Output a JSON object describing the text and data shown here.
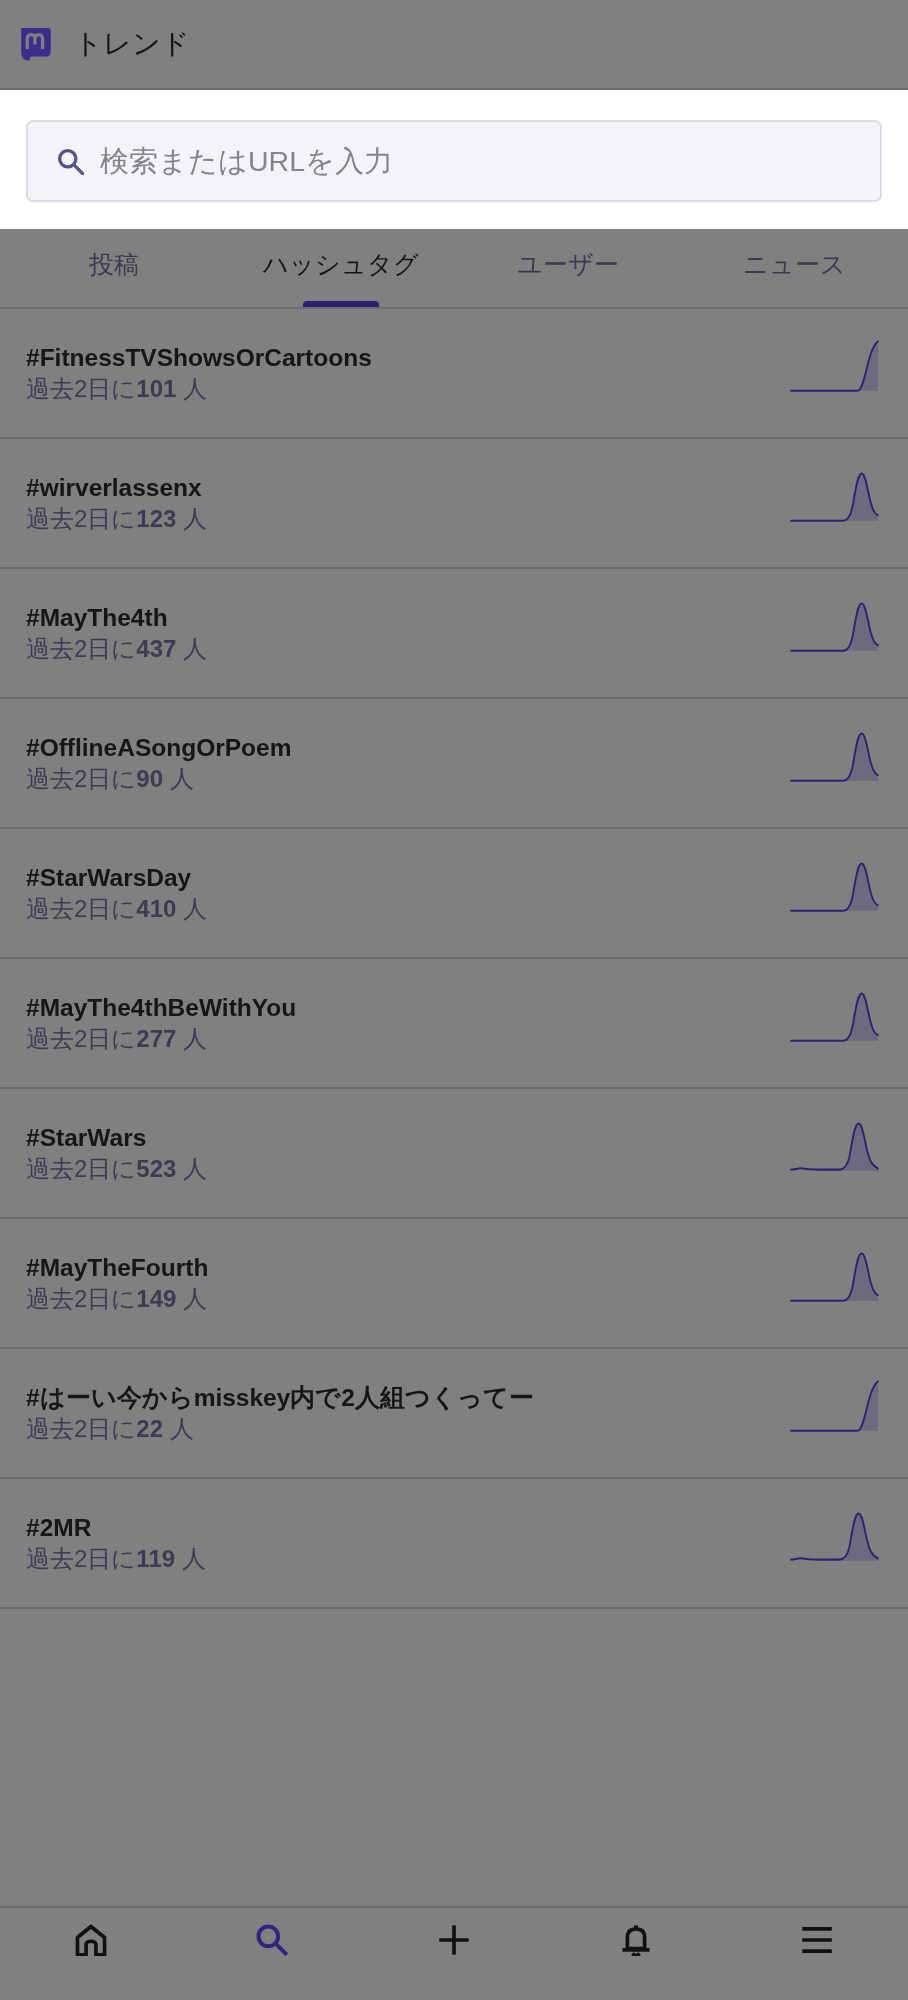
{
  "header": {
    "title": "トレンド"
  },
  "search": {
    "placeholder": "検索またはURLを入力"
  },
  "tabs": [
    {
      "label": "投稿",
      "selected": false
    },
    {
      "label": "ハッシュタグ",
      "selected": true
    },
    {
      "label": "ユーザー",
      "selected": false
    },
    {
      "label": "ニュース",
      "selected": false
    }
  ],
  "trends": [
    {
      "tag": "#FitnessTVShowsOrCartoons",
      "usage": "過去2日に**101** 人",
      "kind": "rise"
    },
    {
      "tag": "#wirverlassenx",
      "usage": "過去2日に**123** 人",
      "kind": "peak"
    },
    {
      "tag": "#MayThe4th",
      "usage": "過去2日に**437** 人",
      "kind": "peak"
    },
    {
      "tag": "#OfflineASongOrPoem",
      "usage": "過去2日に**90** 人",
      "kind": "peak"
    },
    {
      "tag": "#StarWarsDay",
      "usage": "過去2日に**410** 人",
      "kind": "peak"
    },
    {
      "tag": "#MayThe4thBeWithYou",
      "usage": "過去2日に**277** 人",
      "kind": "peak"
    },
    {
      "tag": "#StarWars",
      "usage": "過去2日に**523** 人",
      "kind": "wavy"
    },
    {
      "tag": "#MayTheFourth",
      "usage": "過去2日に**149** 人",
      "kind": "peak"
    },
    {
      "tag": "#はーい今からmisskey内で2人組つくってー",
      "usage": "過去2日に**22** 人",
      "kind": "rise"
    },
    {
      "tag": "#2MR",
      "usage": "過去2日に**119** 人",
      "kind": "wavy"
    }
  ],
  "bottom_nav": [
    {
      "kind": "home",
      "selected": false
    },
    {
      "kind": "search",
      "selected": true
    },
    {
      "kind": "compose",
      "selected": false
    },
    {
      "kind": "notifications",
      "selected": false
    },
    {
      "kind": "menu",
      "selected": false
    }
  ]
}
